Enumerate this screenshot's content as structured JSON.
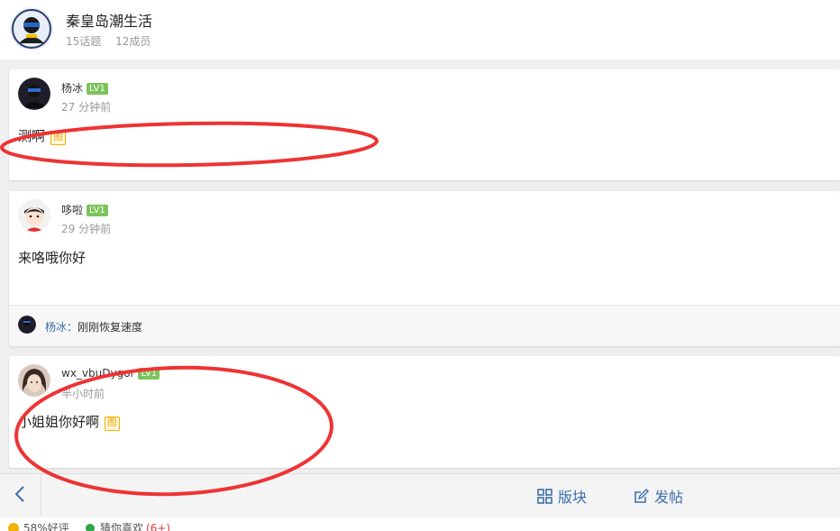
{
  "group": {
    "title": "秦皇岛潮生活",
    "topics": "15话题",
    "members": "12成员"
  },
  "posts": [
    {
      "author": "杨冰",
      "level": "LV1",
      "time": "27 分钟前",
      "content": "测啊",
      "image_badge": "图"
    },
    {
      "author": "哆啦",
      "level": "LV1",
      "time": "29 分钟前",
      "content": "来咯哦你好",
      "reply": {
        "name": "杨冰：",
        "text": "刚刚恢复速度"
      }
    },
    {
      "author": "wx_vbuDygor",
      "level": "LV1",
      "time": "半小时前",
      "content": "小姐姐你好啊",
      "image_badge": "图"
    }
  ],
  "toolbar": {
    "board_label": "版块",
    "post_label": "发帖"
  },
  "status": {
    "rating": "58%好评",
    "guess_label": "猜你喜欢",
    "guess_count": "(6+)"
  },
  "colors": {
    "accent": "#3b6fb0",
    "level_badge": "#7dc35b",
    "annotation": "#ee3333"
  }
}
